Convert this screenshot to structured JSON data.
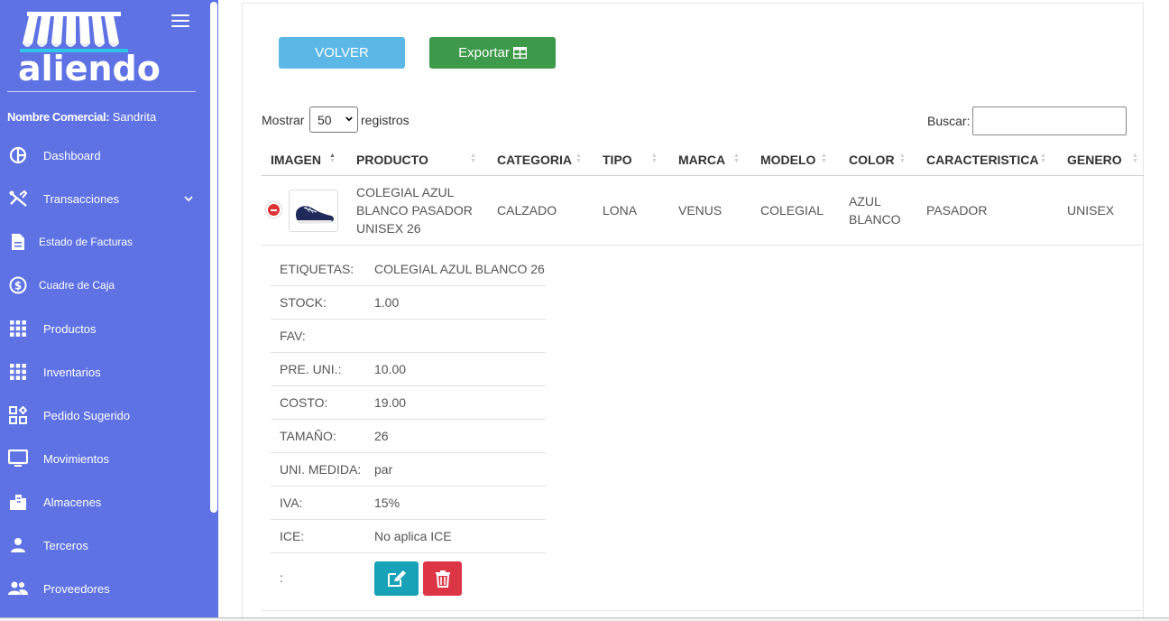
{
  "app": {
    "brand": "aliendo",
    "merchant_label": "Nombre Comercial:",
    "merchant_name": "Sandrita"
  },
  "sidebar": {
    "items": [
      {
        "label": "Dashboard",
        "icon": "pie-chart-icon"
      },
      {
        "label": "Transacciones",
        "icon": "tools-icon",
        "expandable": true
      },
      {
        "label": "Estado de Facturas",
        "icon": "document-icon"
      },
      {
        "label": "Cuadre de Caja",
        "icon": "dollar-circle-icon"
      },
      {
        "label": "Productos",
        "icon": "grid-icon"
      },
      {
        "label": "Inventarios",
        "icon": "grid-icon"
      },
      {
        "label": "Pedido Sugerido",
        "icon": "widgets-icon"
      },
      {
        "label": "Movimientos",
        "icon": "monitor-icon"
      },
      {
        "label": "Almacenes",
        "icon": "buildings-icon"
      },
      {
        "label": "Terceros",
        "icon": "person-icon"
      },
      {
        "label": "Proveedores",
        "icon": "people-icon"
      }
    ]
  },
  "toolbar": {
    "back_label": "VOLVER",
    "export_label": "Exportar"
  },
  "table_controls": {
    "show_label": "Mostrar",
    "page_size": "50",
    "records_label": "registros",
    "search_label": "Buscar:",
    "search_value": ""
  },
  "table": {
    "columns": [
      "IMAGEN",
      "PRODUCTO",
      "CATEGORIA",
      "TIPO",
      "MARCA",
      "MODELO",
      "COLOR",
      "CARACTERISTICA",
      "GENERO"
    ],
    "row": {
      "producto_lines": [
        "COLEGIAL AZUL",
        "BLANCO PASADOR",
        "UNISEX 26"
      ],
      "categoria": "CALZADO",
      "tipo": "LONA",
      "marca": "VENUS",
      "modelo": "COLEGIAL",
      "color_lines": [
        "AZUL",
        "BLANCO"
      ],
      "caracteristica": "PASADOR",
      "genero": "UNISEX"
    }
  },
  "details": [
    {
      "label": "ETIQUETAS:",
      "value": "COLEGIAL AZUL BLANCO 26"
    },
    {
      "label": "STOCK:",
      "value": "1.00"
    },
    {
      "label": "FAV:",
      "value": ""
    },
    {
      "label": "PRE. UNI.:",
      "value": "10.00"
    },
    {
      "label": "COSTO:",
      "value": "19.00"
    },
    {
      "label": "TAMAÑO:",
      "value": "26"
    },
    {
      "label": "UNI. MEDIDA:",
      "value": "par"
    },
    {
      "label": "IVA:",
      "value": "15%"
    },
    {
      "label": "ICE:",
      "value": "No aplica ICE"
    },
    {
      "label": ":",
      "value": ""
    }
  ],
  "colors": {
    "sidebar": "#5e72e4",
    "volver": "#5bb8e6",
    "export": "#3c9a4a",
    "edit": "#17a2b8",
    "delete": "#dc3545"
  }
}
